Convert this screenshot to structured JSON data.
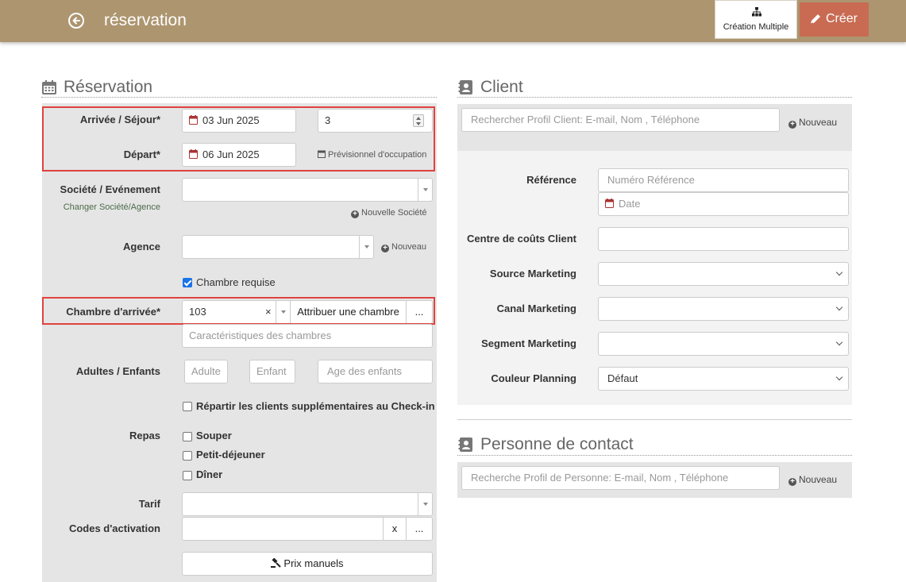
{
  "header": {
    "title": "réservation",
    "multi_label": "Création Multiple",
    "create_label": "Créer",
    "bg_color": "#ad956f",
    "create_color": "#c86b52"
  },
  "reservation": {
    "title": "Réservation",
    "arrival_label": "Arrivée / Séjour*",
    "arrival_date": "03 Jun 2025",
    "nights": "3",
    "departure_label": "Départ*",
    "departure_date": "06 Jun 2025",
    "occupancy_link": "Prévisionnel d'occupation",
    "company_label": "Société / Evénement",
    "change_company_link": "Changer Société/Agence",
    "new_company_link": "Nouvelle Société",
    "agency_label": "Agence",
    "agency_new_link": "Nouveau",
    "room_required_label": "Chambre requise",
    "room_required_checked": true,
    "arrival_room_label": "Chambre d'arrivée*",
    "room_value": "103",
    "room_clear": "×",
    "assign_room_label": "Attribuer une chambre",
    "more_label": "...",
    "room_features_placeholder": "Caractéristiques des chambres",
    "guests_label": "Adultes / Enfants",
    "adult_placeholder": "Adulte",
    "child_placeholder": "Enfant",
    "child_age_placeholder": "Age des enfants",
    "distribute_label": "Répartir les clients supplémentaires au Check-in",
    "meals_label": "Repas",
    "meals": [
      "Souper",
      "Petit-déjeuner",
      "Dîner"
    ],
    "rate_label": "Tarif",
    "activation_label": "Codes d'activation",
    "activation_clear": "x",
    "activation_more": "...",
    "manual_prices_label": "Prix manuels"
  },
  "client": {
    "title": "Client",
    "search_placeholder": "Rechercher Profil Client: E-mail, Nom , Téléphone",
    "new_link": "Nouveau",
    "reference_label": "Référence",
    "reference_placeholder": "Numéro Référence",
    "date_placeholder": "Date",
    "cost_center_label": "Centre de coûts Client",
    "source_label": "Source Marketing",
    "channel_label": "Canal Marketing",
    "segment_label": "Segment Marketing",
    "planning_color_label": "Couleur Planning",
    "planning_color_value": "Défaut"
  },
  "contact": {
    "title": "Personne de contact",
    "search_placeholder": "Recherche Profil de Personne: E-mail, Nom , Téléphone",
    "new_link": "Nouveau"
  },
  "icons": {
    "back": "arrow-left-circle-icon",
    "multi": "sitemap-icon",
    "create": "pencil-icon",
    "calendar": "calendar-icon",
    "contact": "contact-card-icon",
    "gavel": "gavel-icon"
  }
}
